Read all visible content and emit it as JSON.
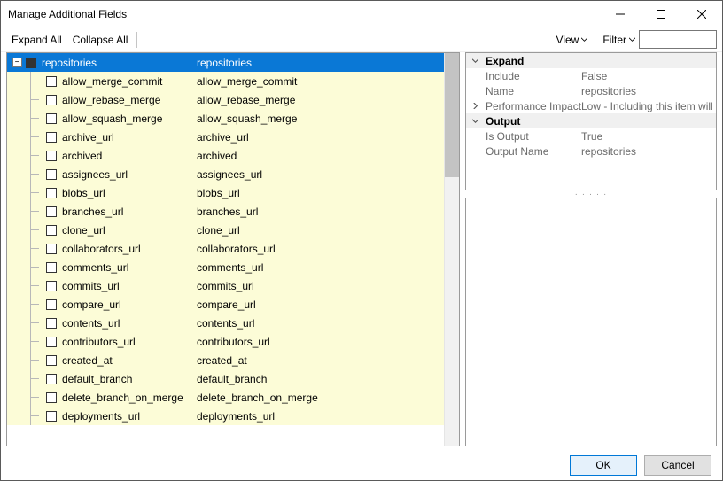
{
  "window": {
    "title": "Manage Additional Fields"
  },
  "titlebar_buttons": {
    "minimize": "minimize",
    "maximize": "maximize",
    "close": "close"
  },
  "toolbar": {
    "expand_all": "Expand All",
    "collapse_all": "Collapse All",
    "view": "View",
    "filter": "Filter",
    "filter_value": ""
  },
  "tree": {
    "root": {
      "name": "repositories",
      "type": "repositories"
    },
    "children": [
      {
        "name": "allow_merge_commit",
        "type": "allow_merge_commit"
      },
      {
        "name": "allow_rebase_merge",
        "type": "allow_rebase_merge"
      },
      {
        "name": "allow_squash_merge",
        "type": "allow_squash_merge"
      },
      {
        "name": "archive_url",
        "type": "archive_url"
      },
      {
        "name": "archived",
        "type": "archived"
      },
      {
        "name": "assignees_url",
        "type": "assignees_url"
      },
      {
        "name": "blobs_url",
        "type": "blobs_url"
      },
      {
        "name": "branches_url",
        "type": "branches_url"
      },
      {
        "name": "clone_url",
        "type": "clone_url"
      },
      {
        "name": "collaborators_url",
        "type": "collaborators_url"
      },
      {
        "name": "comments_url",
        "type": "comments_url"
      },
      {
        "name": "commits_url",
        "type": "commits_url"
      },
      {
        "name": "compare_url",
        "type": "compare_url"
      },
      {
        "name": "contents_url",
        "type": "contents_url"
      },
      {
        "name": "contributors_url",
        "type": "contributors_url"
      },
      {
        "name": "created_at",
        "type": "created_at"
      },
      {
        "name": "default_branch",
        "type": "default_branch"
      },
      {
        "name": "delete_branch_on_merge",
        "type": "delete_branch_on_merge"
      },
      {
        "name": "deployments_url",
        "type": "deployments_url"
      }
    ]
  },
  "properties": {
    "expand": {
      "header": "Expand",
      "include_key": "Include",
      "include_val": "False",
      "name_key": "Name",
      "name_val": "repositories",
      "perf_key": "Performance Impact",
      "perf_val": "Low - Including this item will have ..."
    },
    "output": {
      "header": "Output",
      "is_output_key": "Is Output",
      "is_output_val": "True",
      "output_name_key": "Output Name",
      "output_name_val": "repositories"
    }
  },
  "footer": {
    "ok": "OK",
    "cancel": "Cancel"
  }
}
